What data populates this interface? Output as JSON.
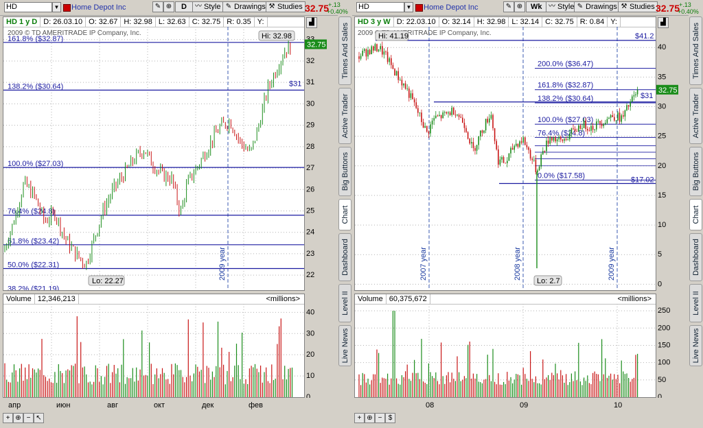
{
  "left": {
    "symbol": "HD",
    "company": "Home Depot Inc",
    "period": "D",
    "style_label": "Style",
    "drawings_label": "Drawings",
    "studies_label": "Studies",
    "last_price": "32.75",
    "change": "+.13",
    "change_pct": "+0.40%",
    "info": {
      "title": "HD 1 y D",
      "date": "D: 26.03.10",
      "open": "O: 32.67",
      "high": "H: 32.98",
      "low": "L: 32.63",
      "close": "C: 32.75",
      "range": "R: 0.35",
      "y": "Y:"
    },
    "copyright": "2009 © TD AMERITRADE IP Company, Inc.",
    "hi_label": "Hi: 32.98",
    "lo_label": "Lo: 22.27",
    "price_tag": "32.75",
    "tag31": "$31",
    "fib_labels": [
      "161.8%  ($32.87)",
      "138.2%  ($30.64)",
      "100.0%  ($27.03)",
      "76.4%  ($24.8)",
      "61.8%  ($23.42)",
      "50.0%  ($22.31)",
      "38.2%  ($21.19)"
    ],
    "year_label": "2009 year",
    "y_ticks": [
      "33",
      "32",
      "31",
      "30",
      "29",
      "28",
      "27",
      "26",
      "25",
      "24",
      "23",
      "22"
    ],
    "volume_title": "Volume",
    "volume_value": "12,346,213",
    "volume_units": "<millions>",
    "vol_ticks": [
      "40",
      "30",
      "20",
      "10",
      "0"
    ],
    "x_ticks": [
      "апр",
      "июн",
      "авг",
      "окт",
      "дек",
      "фев"
    ]
  },
  "right": {
    "symbol": "HD",
    "company": "Home Depot Inc",
    "period": "Wk",
    "style_label": "Style",
    "drawings_label": "Drawings",
    "studies_label": "Studies",
    "last_price": "32.75",
    "change": "+.13",
    "change_pct": "+0.40%",
    "info": {
      "title": "HD 3 y W",
      "date": "D: 22.03.10",
      "open": "O: 32.14",
      "high": "H: 32.98",
      "low": "L: 32.14",
      "close": "C: 32.75",
      "range": "R: 0.84",
      "y": "Y:"
    },
    "copyright": "2009 © TD AMERITRADE IP Company, Inc.",
    "hi_label": "Hi: 41.19",
    "lo_label": "Lo: 2.7",
    "price_tag": "32.75",
    "tag31": "$31",
    "tag412": "$41.2",
    "tag1702": "$17.02",
    "fib_labels": [
      "200.0%  ($36.47)",
      "161.8%  ($32.87)",
      "138.2%  ($30.64)",
      "100.0%  ($27.03)",
      "76.4%  ($24.8)",
      "0.0%  ($17.58)"
    ],
    "year_labels": [
      "2007 year",
      "2008 year",
      "2009 year"
    ],
    "y_ticks": [
      "40",
      "35",
      "30",
      "25",
      "20",
      "15",
      "10",
      "5",
      "0"
    ],
    "volume_title": "Volume",
    "volume_value": "60,375,672",
    "volume_units": "<millions>",
    "vol_ticks": [
      "250",
      "200",
      "150",
      "100",
      "50",
      "0"
    ],
    "x_ticks": [
      "08",
      "09",
      "10"
    ]
  },
  "side_tabs": [
    "Times And Sales",
    "Active Trader",
    "Big Buttons",
    "Chart",
    "Dashboard",
    "Level II",
    "Live News"
  ],
  "colors": {
    "up": "#1a8c1a",
    "down": "#c81414",
    "fib": "#1a1aa0",
    "accent": "#c00000"
  }
}
